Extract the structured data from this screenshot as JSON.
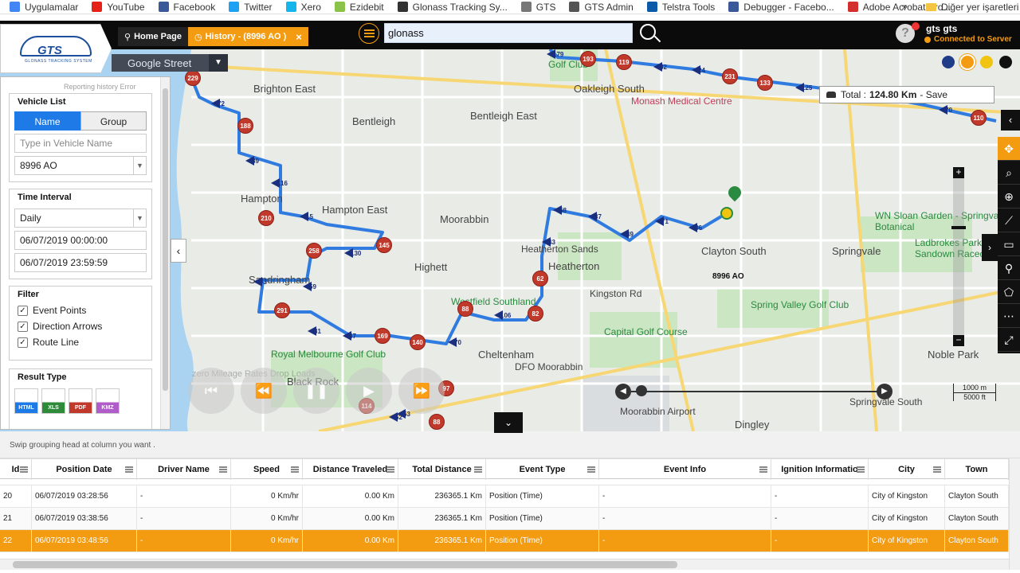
{
  "bookmarks": [
    {
      "label": "Uygulamalar",
      "icon": "apps-grid-icon",
      "color": "#4285f4"
    },
    {
      "label": "YouTube",
      "icon": "youtube-icon",
      "color": "#e62117"
    },
    {
      "label": "Facebook",
      "icon": "facebook-icon",
      "color": "#3b5998"
    },
    {
      "label": "Twitter",
      "icon": "twitter-icon",
      "color": "#1da1f2"
    },
    {
      "label": "Xero",
      "icon": "xero-icon",
      "color": "#13b5ea"
    },
    {
      "label": "Ezidebit",
      "icon": "ezidebit-icon",
      "color": "#8bc34a"
    },
    {
      "label": "Glonass Tracking Sy...",
      "icon": "github-icon",
      "color": "#333333"
    },
    {
      "label": "GTS",
      "icon": "gts-icon",
      "color": "#777777"
    },
    {
      "label": "GTS Admin",
      "icon": "gts-admin-icon",
      "color": "#555555"
    },
    {
      "label": "Telstra Tools",
      "icon": "telstra-icon",
      "color": "#0a5aa8"
    },
    {
      "label": "Debugger - Facebo...",
      "icon": "facebook-icon",
      "color": "#3b5998"
    },
    {
      "label": "Adobe Acrobat Pro...",
      "icon": "adobe-icon",
      "color": "#d32f2f"
    }
  ],
  "bookmarks_more": "»",
  "bookmarks_other": "Diğer yer işaretleri",
  "header": {
    "home_tab": "Home Page",
    "history_tab": "History - (8996 AO )",
    "close_tab": "×",
    "search_value": "glonass",
    "user_name": "gts gts",
    "user_status": "Connected to Server",
    "avatar_glyph": "?"
  },
  "logo": {
    "text": "GTS",
    "subtitle": "GLONASS TRACKING SYSTEM"
  },
  "map": {
    "map_type": "Google Street",
    "total_label": "Total :",
    "total_value": "124.80 Km",
    "total_save": "- Save",
    "theme_colors": [
      "#1f3c88",
      "#f39c12",
      "#f1c40f",
      "#111111"
    ],
    "vehicle_label": "8996 AO",
    "ghost_text": "zero Mileage Rates Drop Loads",
    "ghost_top": "Reporting history Error",
    "scale_top": "1000 m",
    "scale_bottom": "5000 ft",
    "labels": [
      {
        "text": "Brighton East",
        "type": "big"
      },
      {
        "text": "Bentleigh",
        "type": "big"
      },
      {
        "text": "Bentleigh East",
        "type": "big"
      },
      {
        "text": "Oakleigh South",
        "type": "big"
      },
      {
        "text": "Monash Medical Centre",
        "type": "pink"
      },
      {
        "text": "Hampton",
        "type": "big"
      },
      {
        "text": "Hampton East",
        "type": "big"
      },
      {
        "text": "Moorabbin",
        "type": "big"
      },
      {
        "text": "Heatherton Sands",
        "type": ""
      },
      {
        "text": "Heatherton",
        "type": "big"
      },
      {
        "text": "Clayton South",
        "type": "big"
      },
      {
        "text": "Springvale",
        "type": "big"
      },
      {
        "text": "WN Sloan Garden - Springvale Botanical",
        "type": "green"
      },
      {
        "text": "Ladbrokes Park Sandown Racecourse",
        "type": "green"
      },
      {
        "text": "Sandringham",
        "type": "big"
      },
      {
        "text": "Highett",
        "type": "big"
      },
      {
        "text": "Westfield Southland",
        "type": "green"
      },
      {
        "text": "Kingston Rd",
        "type": ""
      },
      {
        "text": "Spring Valley Golf Club",
        "type": "green"
      },
      {
        "text": "Capital Golf Course",
        "type": "green"
      },
      {
        "text": "Royal Melbourne Golf Club",
        "type": "green"
      },
      {
        "text": "Cheltenham",
        "type": "big"
      },
      {
        "text": "DFO Moorabbin",
        "type": ""
      },
      {
        "text": "Black Rock",
        "type": "big"
      },
      {
        "text": "Moorabbin Airport",
        "type": ""
      },
      {
        "text": "Noble Park",
        "type": "big"
      },
      {
        "text": "Springvale South",
        "type": ""
      },
      {
        "text": "Dingley",
        "type": "big"
      },
      {
        "text": "Golf Club",
        "type": "green"
      }
    ],
    "pins": [
      "229",
      "188",
      "210",
      "258",
      "145",
      "291",
      "169",
      "140",
      "88",
      "82",
      "62",
      "97",
      "114",
      "88",
      "193",
      "119",
      "231",
      "133",
      "110"
    ],
    "arrow_numbers": [
      "72",
      "89",
      "116",
      "15",
      "130",
      "73",
      "59",
      "47",
      "81",
      "70",
      "106",
      "58",
      "37",
      "46",
      "71",
      "49",
      "43",
      "52",
      "53",
      "24",
      "82",
      "125",
      "70",
      "179"
    ]
  },
  "panel": {
    "vehicle_list": "Vehicle List",
    "name_btn": "Name",
    "group_btn": "Group",
    "vehicle_placeholder": "Type in Vehicle Name",
    "vehicle_selected": "8996 AO",
    "time_interval": "Time Interval",
    "interval": "Daily",
    "date_from": "06/07/2019 00:00:00",
    "date_to": "06/07/2019 23:59:59",
    "filter": "Filter",
    "filters": [
      "Event Points",
      "Direction Arrows",
      "Route Line"
    ],
    "result_type": "Result Type",
    "results": [
      {
        "label": "HTML",
        "color": "#1d7ae6"
      },
      {
        "label": "XLS",
        "color": "#2e8b3a"
      },
      {
        "label": "PDF",
        "color": "#c0392b"
      },
      {
        "label": "KMZ",
        "color": "#b05cc9"
      }
    ]
  },
  "grid": {
    "group_hint": "Swip grouping head at column you want .",
    "columns": [
      "Id",
      "Position Date",
      "Driver Name",
      "Speed",
      "Distance Traveled",
      "Total Distance",
      "Event Type",
      "Event Info",
      "Ignition Informatio",
      "City",
      "Town"
    ],
    "rows": [
      {
        "id": "20",
        "date": "06/07/2019 03:28:56",
        "driver": "-",
        "speed": "0 Km/hr",
        "dist": "0.00 Km",
        "total": "236365.1 Km",
        "event": "Position (Time)",
        "info": "-",
        "ign": "-",
        "city": "City of Kingston",
        "town": "Clayton South"
      },
      {
        "id": "21",
        "date": "06/07/2019 03:38:56",
        "driver": "-",
        "speed": "0 Km/hr",
        "dist": "0.00 Km",
        "total": "236365.1 Km",
        "event": "Position (Time)",
        "info": "-",
        "ign": "-",
        "city": "City of Kingston",
        "town": "Clayton South"
      },
      {
        "id": "22",
        "date": "06/07/2019 03:48:56",
        "driver": "-",
        "speed": "0 Km/hr",
        "dist": "0.00 Km",
        "total": "236365.1 Km",
        "event": "Position (Time)",
        "info": "-",
        "ign": "-",
        "city": "City of Kingston",
        "town": "Clayton South"
      }
    ]
  }
}
